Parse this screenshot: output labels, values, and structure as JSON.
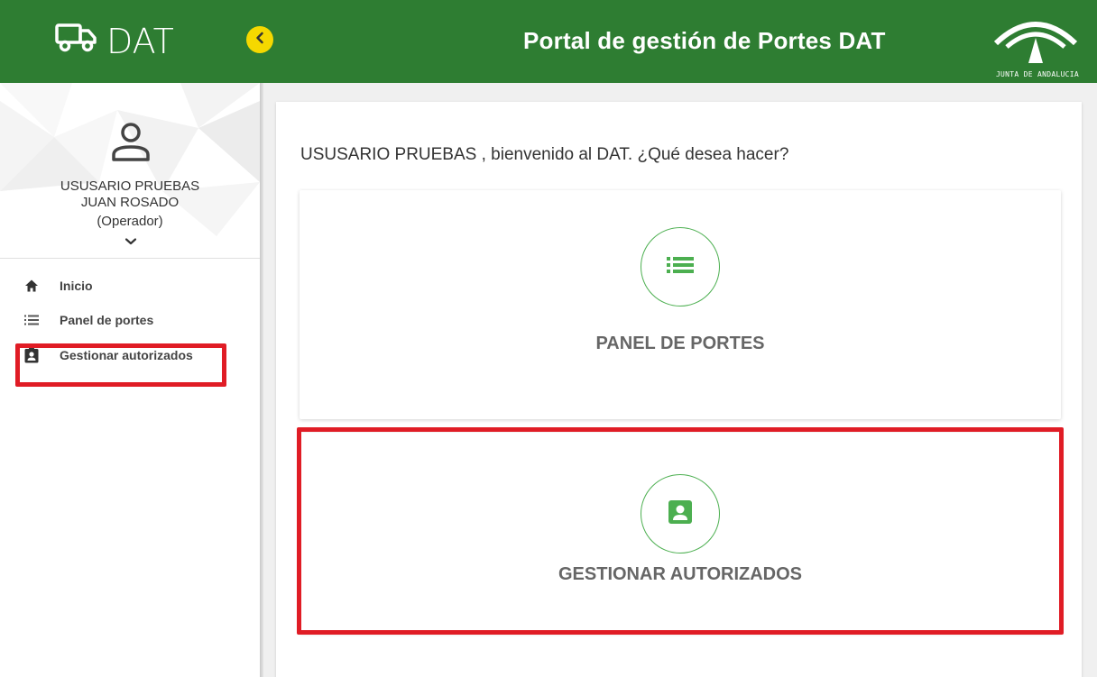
{
  "header": {
    "brand": "DAT",
    "title": "Portal de gestión de Portes DAT",
    "logo_text": "JUNTA DE ANDALUCIA",
    "brand_color": "#2e7d32",
    "accent_color": "#f5d800"
  },
  "profile": {
    "name_line1": "USUSARIO PRUEBAS",
    "name_line2": "JUAN ROSADO",
    "role": "(Operador)"
  },
  "sidebar": {
    "items": [
      {
        "label": "Inicio",
        "icon": "home-icon"
      },
      {
        "label": "Panel de portes",
        "icon": "list-icon"
      },
      {
        "label": "Gestionar autorizados",
        "icon": "contact-card-icon"
      }
    ]
  },
  "main": {
    "welcome": "USUSARIO PRUEBAS , bienvenido al DAT. ¿Qué desea hacer?",
    "cards": [
      {
        "label": "PANEL DE PORTES",
        "icon": "list-icon"
      },
      {
        "label": "GESTIONAR AUTORIZADOS",
        "icon": "contact-card-icon"
      }
    ]
  },
  "annotations": {
    "highlight_color": "#e01c25"
  }
}
